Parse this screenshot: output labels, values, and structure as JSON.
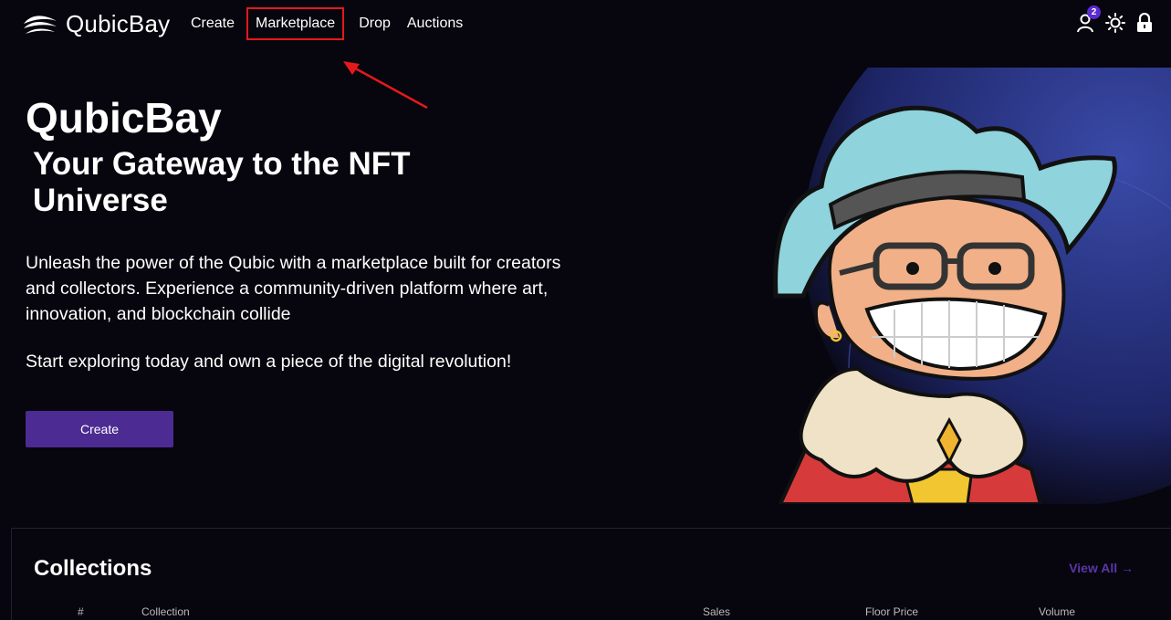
{
  "brand": {
    "name": "QubicBay",
    "logo_icon": "wave-logo-icon"
  },
  "nav": {
    "links": [
      {
        "label": "Create"
      },
      {
        "label": "Marketplace"
      },
      {
        "label": "Drop"
      },
      {
        "label": "Auctions"
      }
    ],
    "user_icon": "user-icon",
    "notification_count": "2",
    "theme_icon": "sun-icon",
    "lock_icon": "lock-icon"
  },
  "hero": {
    "title": "QubicBay",
    "subtitle": "Your Gateway to the NFT Universe",
    "description": "Unleash the power of the Qubic with a marketplace built for creators and collectors. Experience a community-driven platform where art, innovation, and blockchain collide",
    "cta_text": "Start exploring today and own a piece of the digital revolution!",
    "create_button": "Create",
    "image": "cowboy-hat-character-illustration"
  },
  "collections": {
    "title": "Collections",
    "view_all": "View All →",
    "columns": [
      "#",
      "Collection",
      "Sales",
      "Floor Price",
      "Volume"
    ]
  },
  "colors": {
    "background": "#07050d",
    "accent": "#4c2b92",
    "annotation": "#e3191b",
    "link": "#5b36a8"
  }
}
